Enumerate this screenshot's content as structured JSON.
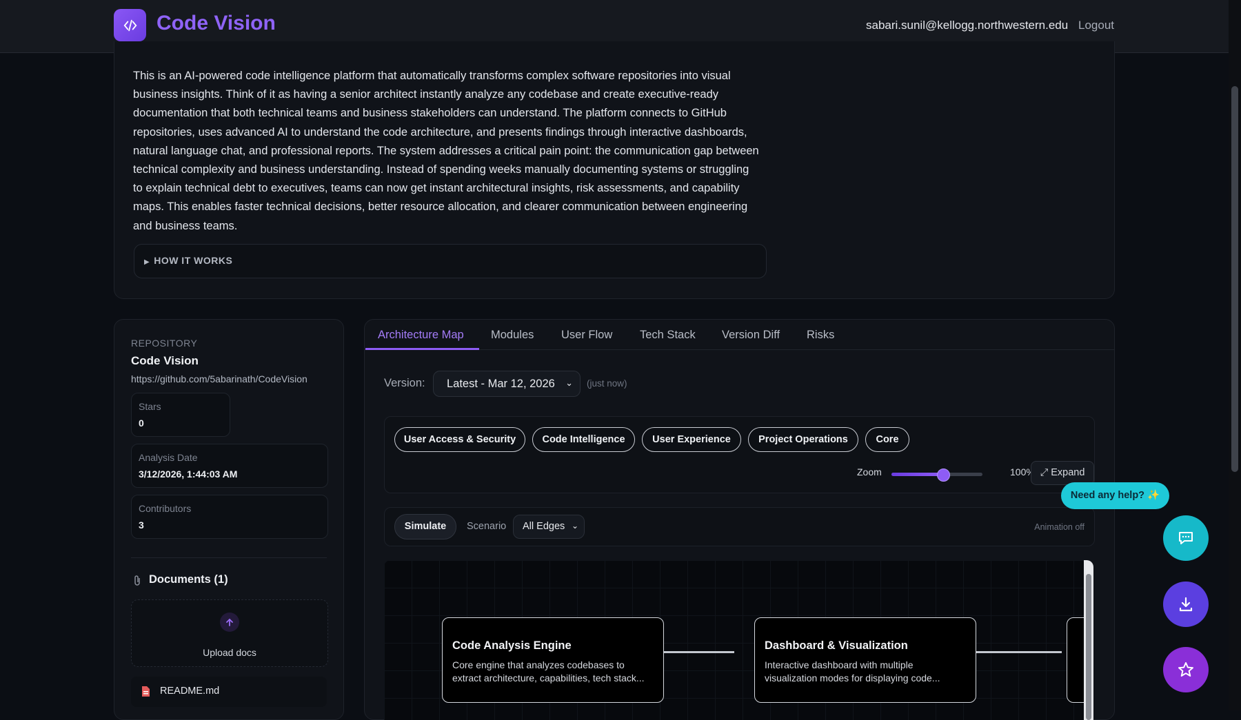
{
  "header": {
    "brand": "Code Vision",
    "email": "sabari.sunil@kellogg.northwestern.edu",
    "logout_label": "Logout"
  },
  "intro": {
    "description": "This is an AI-powered code intelligence platform that automatically transforms complex software repositories into visual business insights. Think of it as having a senior architect instantly analyze any codebase and create executive-ready documentation that both technical teams and business stakeholders can understand. The platform connects to GitHub repositories, uses advanced AI to understand the code architecture, and presents findings through interactive dashboards, natural language chat, and professional reports. The system addresses a critical pain point: the communication gap between technical complexity and business understanding. Instead of spending weeks manually documenting systems or struggling to explain technical debt to executives, teams can now get instant architectural insights, risk assessments, and capability maps. This enables faster technical decisions, better resource allocation, and clearer communication between engineering and business teams.",
    "how_it_works": "HOW IT WORKS"
  },
  "repo": {
    "caption": "REPOSITORY",
    "name": "Code Vision",
    "url": "https://github.com/5abarinath/CodeVision",
    "stats": [
      {
        "label": "Stars",
        "value": "0"
      },
      {
        "label": "Analysis Date",
        "value": "3/12/2026, 1:44:03 AM"
      },
      {
        "label": "Contributors",
        "value": "3"
      }
    ],
    "documents_title": "Documents (1)",
    "upload_label": "Upload docs",
    "files": [
      "README.md"
    ]
  },
  "tabs": [
    "Architecture Map",
    "Modules",
    "User Flow",
    "Tech Stack",
    "Version Diff",
    "Risks"
  ],
  "active_tab": "Architecture Map",
  "version": {
    "label": "Version:",
    "selected": "Latest - Mar 12, 2026",
    "note": "(just now)"
  },
  "filters": [
    "User Access & Security",
    "Code Intelligence",
    "User Experience",
    "Project Operations",
    "Core"
  ],
  "zoom": {
    "label": "Zoom",
    "value_text": "100%",
    "level": 0.56,
    "expand_label": "Expand"
  },
  "simulate": {
    "button": "Simulate",
    "scenario_label": "Scenario",
    "scenario_selected": "All Edges",
    "animation_note": "Animation off"
  },
  "nodes": [
    {
      "title": "Code Analysis Engine",
      "desc": "Core engine that analyzes codebases to extract architecture, capabilities, tech stack..."
    },
    {
      "title": "Dashboard & Visualization",
      "desc": "Interactive dashboard with multiple visualization modes for displaying code..."
    }
  ],
  "help": {
    "bubble": "Need any help? ✨"
  },
  "icons": {
    "logo": "code-icon",
    "chat": "chat-icon",
    "download": "download-icon",
    "star": "star-icon",
    "upload": "upload-icon",
    "file": "file-icon",
    "paperclip": "paperclip-icon"
  },
  "colors": {
    "accent": "#8e5cf5",
    "help": "#1ec9d8"
  }
}
